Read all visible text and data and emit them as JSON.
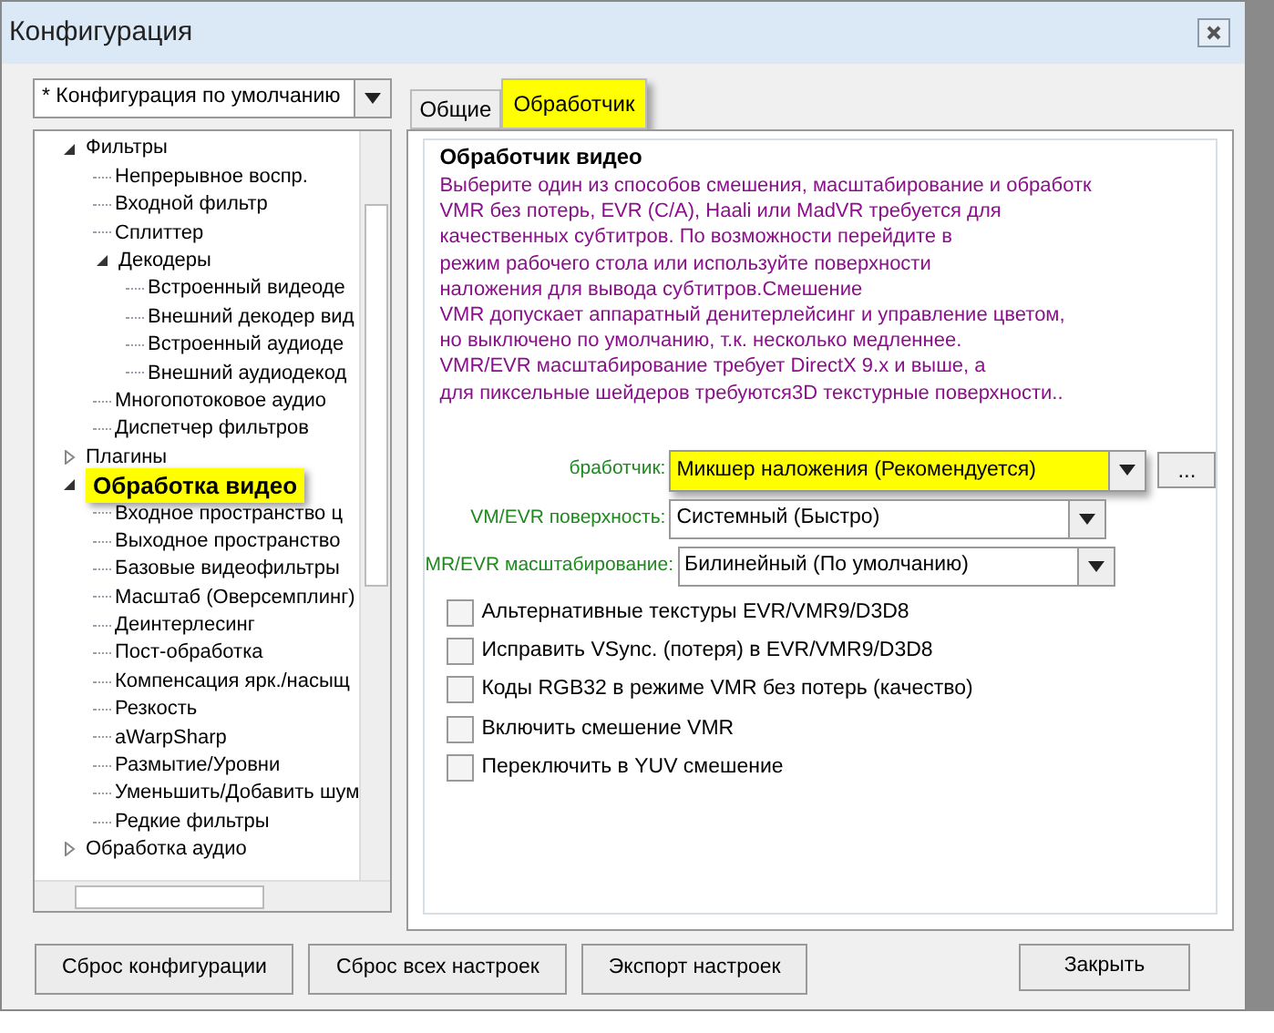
{
  "window": {
    "title": "Конфигурация"
  },
  "config_select": {
    "value": "* Конфигурация по умолчанию"
  },
  "tree": [
    {
      "label": "Фильтры",
      "selected": false,
      "expanded": true,
      "children": [
        {
          "label": "Непрерывное воспр.",
          "selected": false
        },
        {
          "label": "Входной фильтр",
          "selected": false
        },
        {
          "label": "Сплиттер",
          "selected": false
        },
        {
          "label": "Декодеры",
          "selected": false,
          "expanded": true,
          "children": [
            {
              "label": "Встроенный видеоде",
              "selected": false
            },
            {
              "label": "Внешний декодер вид",
              "selected": false
            },
            {
              "label": "Встроенный аудиоде",
              "selected": false
            },
            {
              "label": "Внешний аудиодекод",
              "selected": false
            }
          ]
        },
        {
          "label": "Многопотоковое аудио",
          "selected": false
        },
        {
          "label": "Диспетчер фильтров",
          "selected": false
        }
      ]
    },
    {
      "label": "Плагины",
      "selected": false,
      "expanded": false
    },
    {
      "label": "Обработка видео",
      "selected": true,
      "expanded": true,
      "children": [
        {
          "label": "Входное пространство ц",
          "selected": false
        },
        {
          "label": "Выходное пространство",
          "selected": false
        },
        {
          "label": "Базовые видеофильтры",
          "selected": false
        },
        {
          "label": "Масштаб (Оверсемплинг)",
          "selected": false
        },
        {
          "label": "Деинтерлесинг",
          "selected": false
        },
        {
          "label": "Пост-обработка",
          "selected": false
        },
        {
          "label": "Компенсация ярк./насыщ",
          "selected": false
        },
        {
          "label": "Резкость",
          "selected": false
        },
        {
          "label": "aWarpSharp",
          "selected": false
        },
        {
          "label": "Размытие/Уровни",
          "selected": false
        },
        {
          "label": "Уменьшить/Добавить шум",
          "selected": false
        },
        {
          "label": "Редкие фильтры",
          "selected": false
        }
      ]
    },
    {
      "label": "Обработка аудио",
      "selected": false,
      "expanded": false
    }
  ],
  "tabs": [
    {
      "label": "Общие",
      "selected": false
    },
    {
      "label": "Обработчик",
      "selected": true
    }
  ],
  "group": {
    "title": "Обработчик видео",
    "description": [
      "Выберите один из способов смешения, масштабирование и обработк",
      "VMR без потерь, EVR (C/A), Haali или MadVR требуется для",
      "качественных субтитров. По возможности перейдите в",
      "режим рабочего стола или используйте поверхности",
      "наложения для вывода субтитров.Смешение",
      "VMR допускает аппаратный денитерлейсинг и управление цветом,",
      "но выключено по умолчанию, т.к. несколько медленнее.",
      "VMR/EVR масштабирование требует DirectX 9.x и выше, а",
      "для пиксельные шейдеров требуются3D текстурные поверхности.."
    ],
    "selects": [
      {
        "label": "бработчик:",
        "value": "Микшер наложения (Рекомендуется)",
        "highlighted": true,
        "extra_button": "..."
      },
      {
        "label": "VM/EVR поверхность:",
        "value": "Системный (Быстро)",
        "highlighted": false
      },
      {
        "label": "MR/EVR масштабирование:",
        "value": "Билинейный (По умолчанию)",
        "highlighted": false
      }
    ],
    "checkboxes": [
      {
        "label": "Альтернативные текстуры EVR/VMR9/D3D8",
        "checked": false
      },
      {
        "label": "Исправить VSync. (потеря) в EVR/VMR9/D3D8",
        "checked": false
      },
      {
        "label": "Коды RGB32 в режиме VMR без потерь (качество)",
        "checked": false
      },
      {
        "label": "Включить смешение VMR",
        "checked": false
      },
      {
        "label": "Переключить в YUV смешение",
        "checked": false
      }
    ]
  },
  "buttons": [
    "Сброс конфигурации",
    "Сброс всех настроек",
    "Экспорт настроек"
  ],
  "close_button": "Закрыть"
}
